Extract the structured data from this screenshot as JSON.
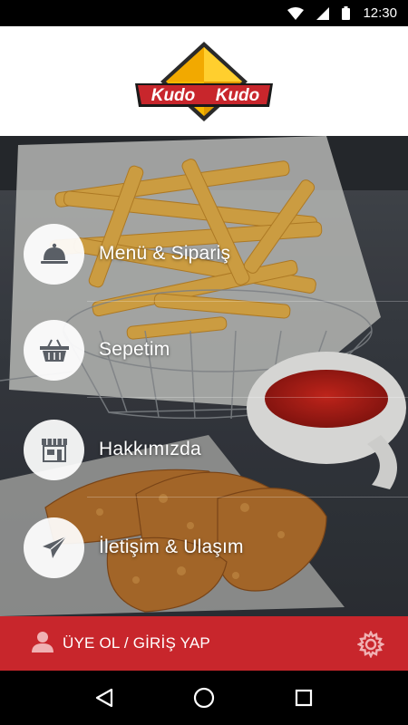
{
  "status_bar": {
    "time": "12:30",
    "icons": [
      "wifi-icon",
      "signal-icon",
      "battery-icon"
    ]
  },
  "header": {
    "logo_left": "Kudo",
    "logo_right": "Kudo"
  },
  "menu": {
    "items": [
      {
        "label": "Menü & Sipariş",
        "icon": "cloche-icon"
      },
      {
        "label": "Sepetim",
        "icon": "basket-icon"
      },
      {
        "label": "Hakkımızda",
        "icon": "store-icon"
      },
      {
        "label": "İletişim & Ulaşım",
        "icon": "send-icon"
      }
    ]
  },
  "footer": {
    "login_label": "ÜYE OL / GİRİŞ YAP",
    "user_icon": "user-icon",
    "settings_icon": "gear-icon"
  },
  "navbar": {
    "icons": [
      "back-icon",
      "home-icon",
      "recents-icon"
    ]
  },
  "colors": {
    "brand_red": "#c8262c",
    "logo_yellow": "#f5b800",
    "icon_gray": "#5a5f66"
  }
}
